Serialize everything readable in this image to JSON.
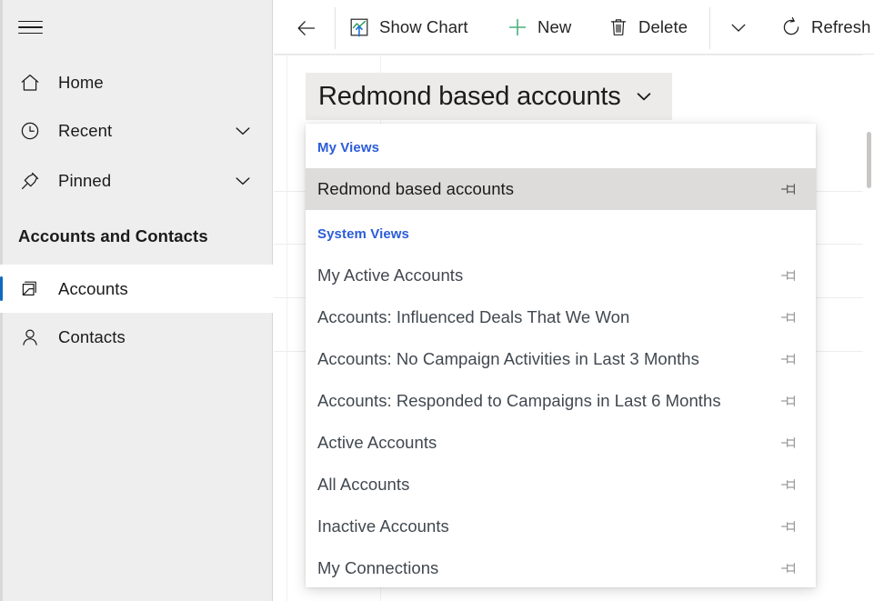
{
  "sidebar": {
    "menu_button": {
      "icon": "hamburger-icon"
    },
    "nav_items": [
      {
        "label": "Home",
        "icon": "home-icon",
        "expandable": false,
        "chevron": ""
      },
      {
        "label": "Recent",
        "icon": "clock-icon",
        "expandable": true,
        "chevron": "chevron-down-icon"
      },
      {
        "label": "Pinned",
        "icon": "pin-icon",
        "expandable": true,
        "chevron": "chevron-down-icon"
      }
    ],
    "group_header": "Accounts and Contacts",
    "entities": [
      {
        "label": "Accounts",
        "icon": "accounts-icon",
        "selected": true
      },
      {
        "label": "Contacts",
        "icon": "contact-person-icon",
        "selected": false
      }
    ]
  },
  "command_bar": {
    "back_button": {
      "label": "Back",
      "icon": "arrow-left-icon"
    },
    "buttons": [
      {
        "label": "Show Chart",
        "icon": "show-chart-icon"
      },
      {
        "label": "New",
        "icon": "plus-icon"
      },
      {
        "label": "Delete",
        "icon": "trash-icon"
      },
      {
        "label": "Refresh",
        "icon": "refresh-icon"
      }
    ],
    "overflow": {
      "icon": "chevron-down-icon"
    }
  },
  "view_selector": {
    "current_view": "Redmond based accounts",
    "chevron": "chevron-down-icon",
    "expanded": true
  },
  "view_dropdown": {
    "groups": [
      {
        "label": "My Views",
        "items": [
          {
            "label": "Redmond based accounts",
            "pin_icon": "pin-icon",
            "selected": true
          }
        ]
      },
      {
        "label": "System Views",
        "items": [
          {
            "label": "My Active Accounts",
            "pin_icon": "pin-icon",
            "selected": false
          },
          {
            "label": "Accounts: Influenced Deals That We Won",
            "pin_icon": "pin-icon",
            "selected": false
          },
          {
            "label": "Accounts: No Campaign Activities in Last 3 Months",
            "pin_icon": "pin-icon",
            "selected": false
          },
          {
            "label": "Accounts: Responded to Campaigns in Last 6 Months",
            "pin_icon": "pin-icon",
            "selected": false
          },
          {
            "label": "Active Accounts",
            "pin_icon": "pin-icon",
            "selected": false
          },
          {
            "label": "All Accounts",
            "pin_icon": "pin-icon",
            "selected": false
          },
          {
            "label": "Inactive Accounts",
            "pin_icon": "pin-icon",
            "selected": false
          },
          {
            "label": "My Connections",
            "pin_icon": "pin-icon",
            "selected": false
          }
        ]
      }
    ]
  },
  "colors": {
    "sidebar_bg": "#eeeeee",
    "selected_accent": "#0f6cbd",
    "group_label": "#2b5cd9",
    "view_button_bg": "#edebe9",
    "dropdown_selected_bg": "#dedcdb",
    "new_icon_green": "#4caf7d",
    "chart_icon_green": "#2e9e5b",
    "chart_arrow_blue": "#1a6fd4",
    "text_primary": "#1b1b1b",
    "text_secondary": "#41484f"
  }
}
